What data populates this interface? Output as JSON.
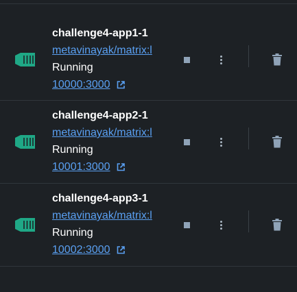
{
  "colors": {
    "background": "#1d2125",
    "divider": "#30363c",
    "text": "#ffffff",
    "link": "#5aa0f2",
    "container_icon": "#1fa886",
    "icon_gray": "#8fa3b8"
  },
  "containers": [
    {
      "name": "challenge4-app1-1",
      "image": "metavinayak/matrix:l",
      "status": "Running",
      "port": "10000:3000",
      "icons": [
        "container-icon",
        "external-link-icon",
        "stop-icon",
        "more-vertical-icon",
        "trash-icon"
      ]
    },
    {
      "name": "challenge4-app2-1",
      "image": "metavinayak/matrix:l",
      "status": "Running",
      "port": "10001:3000",
      "icons": [
        "container-icon",
        "external-link-icon",
        "stop-icon",
        "more-vertical-icon",
        "trash-icon"
      ]
    },
    {
      "name": "challenge4-app3-1",
      "image": "metavinayak/matrix:l",
      "status": "Running",
      "port": "10002:3000",
      "icons": [
        "container-icon",
        "external-link-icon",
        "stop-icon",
        "more-vertical-icon",
        "trash-icon"
      ]
    }
  ]
}
